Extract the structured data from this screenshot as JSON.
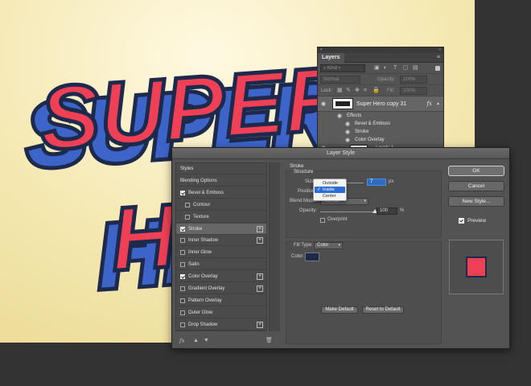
{
  "canvas": {
    "art_text_line1": "SUPER",
    "art_text_line2": "HERO",
    "colors": {
      "face": "#ef4056",
      "side": "#3d64c9",
      "outline": "#1e2a4c",
      "background": "#f5e9b3"
    }
  },
  "layers_panel": {
    "close_glyph": "×",
    "collapse_glyph": "»",
    "tab_label": "Layers",
    "menu_glyph": "≡",
    "kind_label": "Kind",
    "blend_mode": "Normal",
    "opacity_label": "Opacity:",
    "opacity_value": "100%",
    "lock_label": "Lock:",
    "fill_label": "Fill:",
    "fill_value": "100%",
    "layer_name": "Super Hero copy 31",
    "fx_label": "fx",
    "effects_label": "Effects",
    "effects": [
      "Bevel & Emboss",
      "Stroke",
      "Color Overlay"
    ],
    "bottom_layer_name": "Levels 1"
  },
  "dialog": {
    "title": "Layer Style",
    "styles": [
      {
        "label": "Styles",
        "checkbox": null,
        "plus": false,
        "selected": false
      },
      {
        "label": "Blending Options",
        "checkbox": null,
        "plus": false,
        "selected": false
      },
      {
        "label": "Bevel & Emboss",
        "checkbox": true,
        "plus": false,
        "selected": false
      },
      {
        "label": "Contour",
        "checkbox": false,
        "plus": false,
        "selected": false,
        "indent": true
      },
      {
        "label": "Texture",
        "checkbox": false,
        "plus": false,
        "selected": false,
        "indent": true
      },
      {
        "label": "Stroke",
        "checkbox": true,
        "plus": true,
        "selected": true
      },
      {
        "label": "Inner Shadow",
        "checkbox": false,
        "plus": true,
        "selected": false
      },
      {
        "label": "Inner Glow",
        "checkbox": false,
        "plus": false,
        "selected": false
      },
      {
        "label": "Satin",
        "checkbox": false,
        "plus": false,
        "selected": false
      },
      {
        "label": "Color Overlay",
        "checkbox": true,
        "plus": true,
        "selected": false
      },
      {
        "label": "Gradient Overlay",
        "checkbox": false,
        "plus": true,
        "selected": false
      },
      {
        "label": "Pattern Overlay",
        "checkbox": false,
        "plus": false,
        "selected": false
      },
      {
        "label": "Outer Glow",
        "checkbox": false,
        "plus": false,
        "selected": false
      },
      {
        "label": "Drop Shadow",
        "checkbox": false,
        "plus": true,
        "selected": false
      }
    ],
    "footer": {
      "fx": "fx",
      "up": "▲",
      "down": "▼",
      "trash": "🗑"
    },
    "stroke": {
      "section_title": "Stroke",
      "structure_title": "Structure",
      "size_label": "Size:",
      "size_value": "7",
      "size_unit": "px",
      "position_label": "Position:",
      "position_value": "Inside",
      "position_options": [
        "Outside",
        "Inside",
        "Center"
      ],
      "blend_mode_label": "Blend Mode:",
      "blend_mode_value": "Normal",
      "opacity_label": "Opacity:",
      "opacity_value": "100",
      "opacity_unit": "%",
      "overprint_label": "Overprint",
      "fill_type_label": "Fill Type:",
      "fill_type_value": "Color",
      "color_label": "Color:",
      "color_value": "#1e2a4c",
      "make_default": "Make Default",
      "reset_default": "Reset to Default"
    },
    "buttons": {
      "ok": "OK",
      "cancel": "Cancel",
      "new_style": "New Style...",
      "preview": "Preview"
    }
  }
}
